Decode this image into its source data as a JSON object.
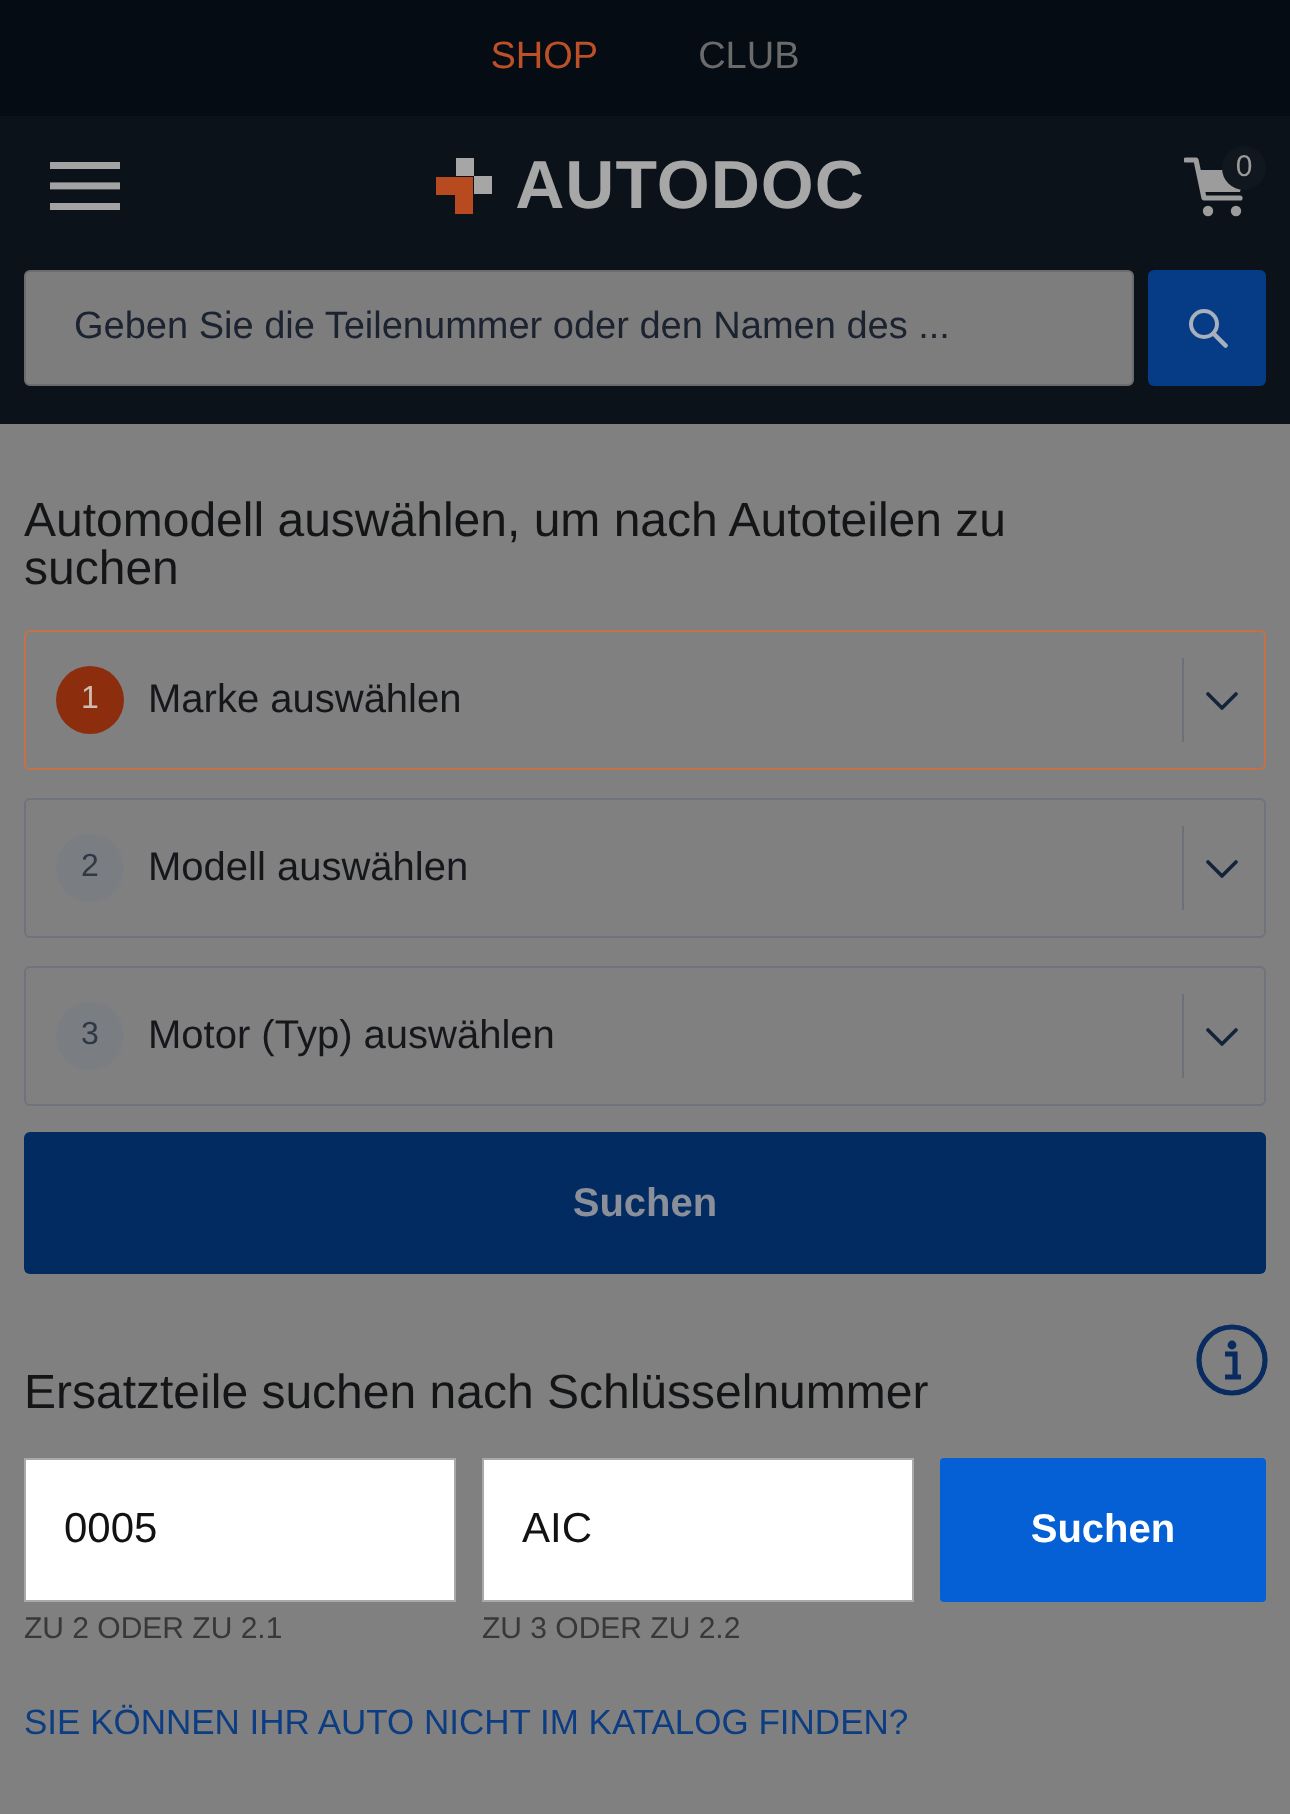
{
  "top_tabs": [
    {
      "label": "SHOP",
      "selected": true
    },
    {
      "label": "CLUB",
      "selected": false
    }
  ],
  "header": {
    "logo": "AUTODOC",
    "cart_count": "0"
  },
  "search": {
    "placeholder": "Geben Sie die Teilenummer oder den Namen des ..."
  },
  "vehicle_search": {
    "title": "Automodell auswählen, um nach Autoteilen zu suchen",
    "steps": [
      {
        "number": "1",
        "label": "Marke auswählen",
        "active": true
      },
      {
        "number": "2",
        "label": "Modell auswählen",
        "active": false
      },
      {
        "number": "3",
        "label": "Motor (Typ) auswählen",
        "active": false
      }
    ],
    "button": "Suchen"
  },
  "key_number_search": {
    "title": "Ersatzteile suchen nach Schlüsselnummer",
    "fields": [
      {
        "value": "0005",
        "caption": "ZU 2 ODER ZU 2.1"
      },
      {
        "value": "AIC",
        "caption": "ZU 3 ODER ZU 2.2"
      }
    ],
    "button": "Suchen"
  },
  "help_link": "SIE KÖNNEN IHR AUTO NICHT IM KATALOG FINDEN?"
}
